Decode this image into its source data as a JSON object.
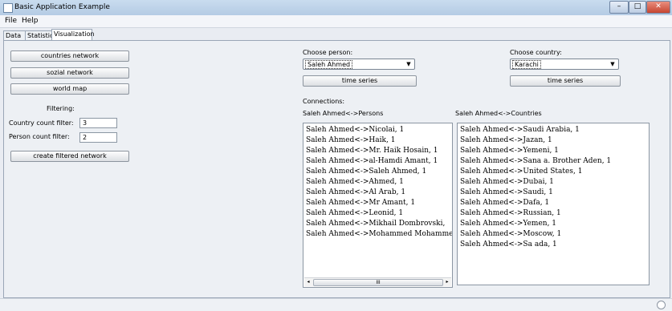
{
  "window": {
    "title": "Basic Application Example",
    "controls": {
      "minimize": "–",
      "maximize": "□",
      "close": "✕"
    }
  },
  "menu": [
    "File",
    "Help"
  ],
  "tabs": [
    {
      "label": "Data",
      "active": false
    },
    {
      "label": "Statistic",
      "active": false
    },
    {
      "label": "Visualization",
      "active": true
    }
  ],
  "left": {
    "buttons": {
      "countries_network": "countries network",
      "sozial_network": "sozial network",
      "world_map": "world map"
    },
    "filtering_label": "Filtering:",
    "country_filter_label": "Country count filter:",
    "country_filter_value": "3",
    "person_filter_label": "Person count filter:",
    "person_filter_value": "2",
    "create_button": "create filtered network"
  },
  "person": {
    "label": "Choose person:",
    "selected": "Saleh Ahmed",
    "time_series": "time series"
  },
  "country": {
    "label": "Choose country:",
    "selected": "Karachi",
    "time_series": "time series"
  },
  "connections": {
    "label": "Connections:",
    "persons_header": "Saleh Ahmed<->Persons",
    "countries_header": "Saleh Ahmed<->Countries",
    "persons": [
      "Saleh Ahmed<->Nicolai, 1",
      "Saleh Ahmed<->Haik, 1",
      "Saleh Ahmed<->Mr. Haik Hosain, 1",
      "Saleh Ahmed<->al-Hamdi Amant, 1",
      "Saleh Ahmed<->Saleh Ahmed, 1",
      "Saleh Ahmed<->Ahmed, 1",
      "Saleh Ahmed<->Al Arab, 1",
      "Saleh Ahmed<->Mr Amant, 1",
      "Saleh Ahmed<->Leonid, 1",
      "Saleh Ahmed<->Mikhail Dombrovski,",
      "Saleh Ahmed<->Mohammed Mohammed,"
    ],
    "countries": [
      "Saleh Ahmed<->Saudi Arabia, 1",
      "Saleh Ahmed<->Jazan, 1",
      "Saleh Ahmed<->Yemeni, 1",
      "Saleh Ahmed<->Sana a. Brother Aden, 1",
      "Saleh Ahmed<->United States, 1",
      "Saleh Ahmed<->Dubai, 1",
      "Saleh Ahmed<->Saudi, 1",
      "Saleh Ahmed<->Dafa, 1",
      "Saleh Ahmed<->Russian, 1",
      "Saleh Ahmed<->Yemen, 1",
      "Saleh Ahmed<->Moscow, 1",
      "Saleh Ahmed<->Sa ada, 1"
    ],
    "scroll": {
      "left": "◂",
      "thumb": "III",
      "right": "▸"
    }
  }
}
